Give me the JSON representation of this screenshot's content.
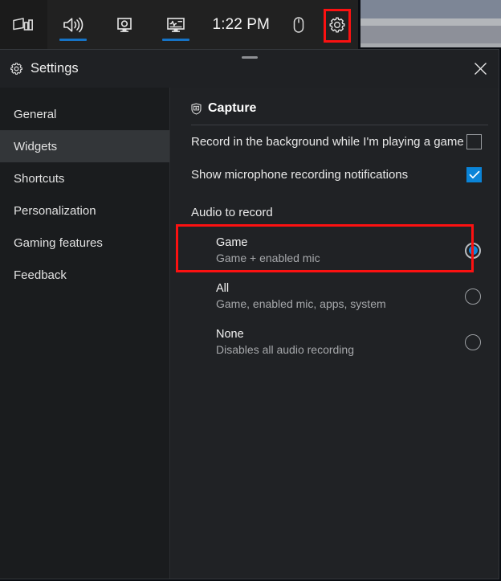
{
  "gamebar": {
    "widgets_menu_icon": "widgets-menu-icon",
    "items": [
      {
        "icon": "audio-icon",
        "active": true
      },
      {
        "icon": "capture-icon",
        "active": false
      },
      {
        "icon": "performance-icon",
        "active": true
      }
    ],
    "clock": "1:22 PM",
    "mouse_icon": "mouse-icon",
    "settings_icon": "gear-icon"
  },
  "settings": {
    "title": "Settings",
    "title_icon": "gear-icon",
    "close_label": "✕"
  },
  "sidebar": {
    "items": [
      {
        "label": "General",
        "selected": false
      },
      {
        "label": "Widgets",
        "selected": true
      },
      {
        "label": "Shortcuts",
        "selected": false
      },
      {
        "label": "Personalization",
        "selected": false
      },
      {
        "label": "Gaming features",
        "selected": false
      },
      {
        "label": "Feedback",
        "selected": false
      }
    ]
  },
  "capture": {
    "section_title": "Capture",
    "section_icon": "capture-shield-icon",
    "toggles": [
      {
        "label": "Record in the background while I'm playing a game",
        "checked": false
      },
      {
        "label": "Show microphone recording notifications",
        "checked": true
      }
    ],
    "audio_group_label": "Audio to record",
    "audio_options": [
      {
        "title": "Game",
        "subtitle": "Game + enabled mic",
        "selected": true,
        "highlighted": true
      },
      {
        "title": "All",
        "subtitle": "Game, enabled mic, apps, system",
        "selected": false,
        "highlighted": false
      },
      {
        "title": "None",
        "subtitle": "Disables all audio recording",
        "selected": false,
        "highlighted": false
      }
    ]
  },
  "annotations": {
    "accent_red": "#fc1111",
    "accent_blue": "#0a84d8"
  }
}
